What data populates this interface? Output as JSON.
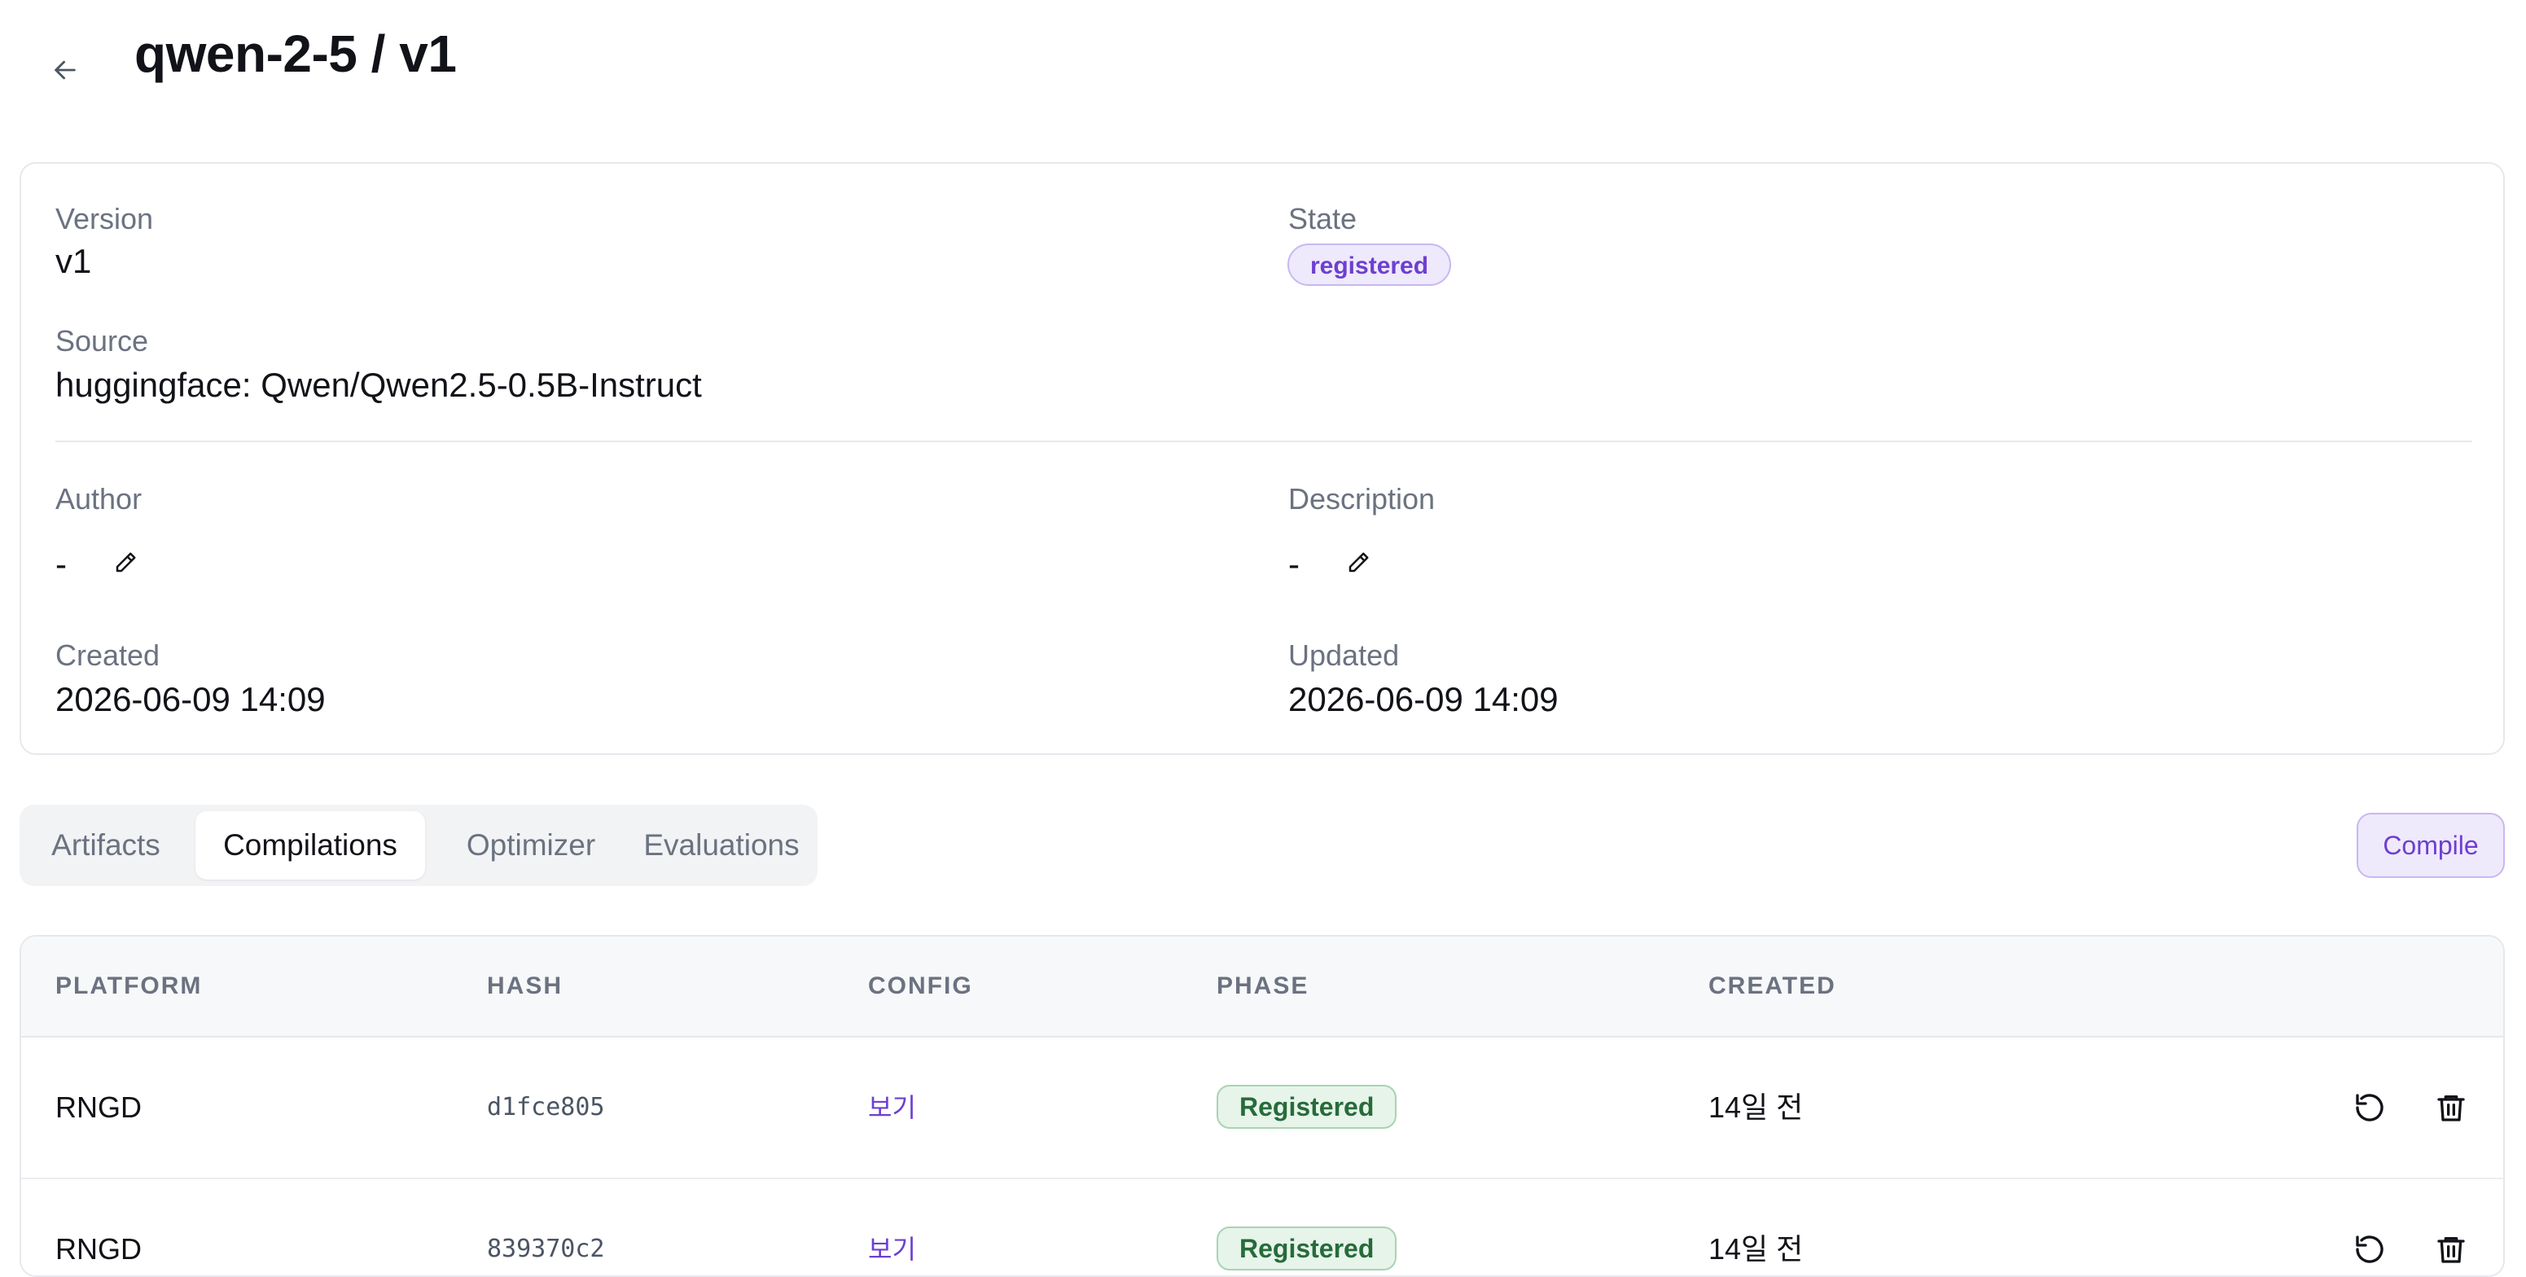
{
  "header": {
    "title": "qwen-2-5 / v1"
  },
  "details": {
    "version_label": "Version",
    "version_value": "v1",
    "state_label": "State",
    "state_value": "registered",
    "source_label": "Source",
    "source_value": "huggingface: Qwen/Qwen2.5-0.5B-Instruct",
    "author_label": "Author",
    "author_value": "-",
    "description_label": "Description",
    "description_value": "-",
    "created_label": "Created",
    "created_value": "2026-06-09 14:09",
    "updated_label": "Updated",
    "updated_value": "2026-06-09 14:09"
  },
  "tabs": [
    {
      "label": "Artifacts"
    },
    {
      "label": "Compilations"
    },
    {
      "label": "Optimizer"
    },
    {
      "label": "Evaluations"
    }
  ],
  "active_tab": "Compilations",
  "compile_button": "Compile",
  "table": {
    "columns": [
      "PLATFORM",
      "HASH",
      "CONFIG",
      "PHASE",
      "CREATED"
    ],
    "rows": [
      {
        "platform": "RNGD",
        "hash": "d1fce805",
        "config": "보기",
        "phase": "Registered",
        "created": "14일 전"
      },
      {
        "platform": "RNGD",
        "hash": "839370c2",
        "config": "보기",
        "phase": "Registered",
        "created": "14일 전"
      }
    ]
  },
  "icons": {
    "back": "arrow-left-icon",
    "edit": "pencil-icon",
    "retry": "rotate-ccw-icon",
    "delete": "trash-icon"
  },
  "colors": {
    "accent": "#6d3fd0",
    "accent_bg": "#efe9fc",
    "success": "#276b3a",
    "success_bg": "#e6f4ea",
    "muted_text": "#6b7280",
    "border": "#e6e8ec"
  }
}
